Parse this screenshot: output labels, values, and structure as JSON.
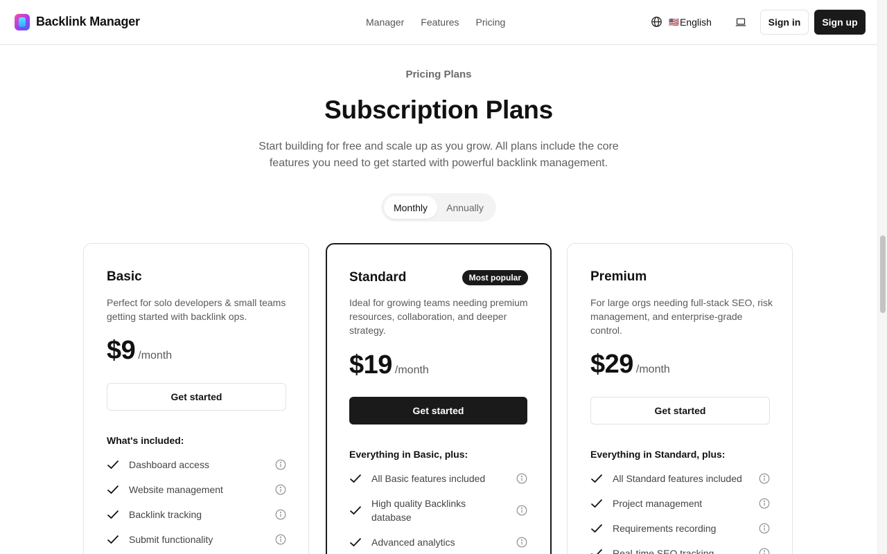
{
  "header": {
    "brand": "Backlink Manager",
    "nav": [
      "Manager",
      "Features",
      "Pricing"
    ],
    "language_flag": "🇺🇸",
    "language_label": "English",
    "sign_in": "Sign in",
    "sign_up": "Sign up"
  },
  "hero": {
    "eyebrow": "Pricing Plans",
    "title": "Subscription Plans",
    "subtitle": "Start building for free and scale up as you grow. All plans include the core features you need to get started with powerful backlink management."
  },
  "billing_toggle": {
    "options": [
      "Monthly",
      "Annually"
    ],
    "selected": "Monthly"
  },
  "plans": [
    {
      "name": "Basic",
      "badge": "",
      "description": "Perfect for solo developers & small teams getting started with backlink ops.",
      "price": "$9",
      "period": "/month",
      "cta": "Get started",
      "features_heading": "What's included:",
      "features": [
        "Dashboard access",
        "Website management",
        "Backlink tracking",
        "Submit functionality"
      ]
    },
    {
      "name": "Standard",
      "badge": "Most popular",
      "description": "Ideal for growing teams needing premium resources, collaboration, and deeper strategy.",
      "price": "$19",
      "period": "/month",
      "cta": "Get started",
      "features_heading": "Everything in Basic, plus:",
      "features": [
        "All Basic features included",
        "High quality Backlinks database",
        "Advanced analytics"
      ]
    },
    {
      "name": "Premium",
      "badge": "",
      "description": "For large orgs needing full-stack SEO, risk management, and enterprise-grade control.",
      "price": "$29",
      "period": "/month",
      "cta": "Get started",
      "features_heading": "Everything in Standard, plus:",
      "features": [
        "All Standard features included",
        "Project management",
        "Requirements recording",
        "Real-time SEO tracking"
      ]
    }
  ],
  "icons": {
    "logo": "backlink-logo-icon",
    "language": "globe-icon",
    "theme": "laptop-icon",
    "feature_check": "check-icon",
    "feature_info": "info-icon"
  },
  "colors": {
    "primary": "#1a1a1a",
    "text": "#111111",
    "muted": "#5f5f5f",
    "border": "#e5e5e5"
  }
}
